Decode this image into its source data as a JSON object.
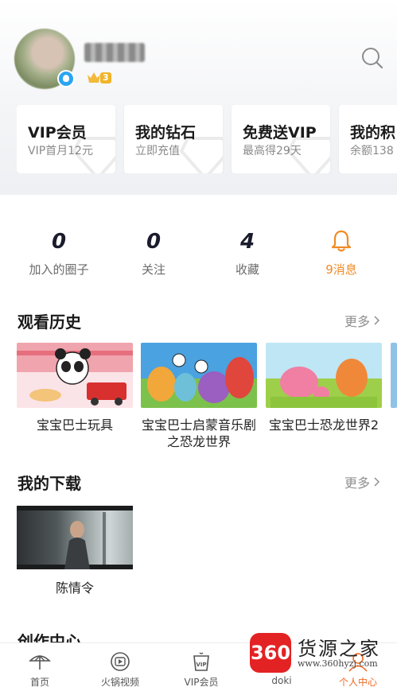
{
  "profile": {
    "level": "3"
  },
  "cards": [
    {
      "title": "VIP会员",
      "subtitle": "VIP首月12元"
    },
    {
      "title": "我的钻石",
      "subtitle": "立即充值"
    },
    {
      "title": "免费送VIP",
      "subtitle": "最高得29天"
    },
    {
      "title": "我的积",
      "subtitle": "余额138"
    }
  ],
  "stats": [
    {
      "value": "0",
      "label": "加入的圈子"
    },
    {
      "value": "0",
      "label": "关注"
    },
    {
      "value": "4",
      "label": "收藏"
    },
    {
      "value": "",
      "label": "9消息"
    }
  ],
  "history": {
    "title": "观看历史",
    "more": "更多",
    "items": [
      {
        "title": "宝宝巴士玩具"
      },
      {
        "title": "宝宝巴士启蒙音乐剧之恐龙世界"
      },
      {
        "title": "宝宝巴士恐龙世界2"
      }
    ]
  },
  "downloads": {
    "title": "我的下载",
    "more": "更多",
    "items": [
      {
        "title": "陈情令"
      }
    ]
  },
  "create": {
    "title": "创作中心"
  },
  "tabs": [
    {
      "label": "首页",
      "icon": "umbrella-icon"
    },
    {
      "label": "火锅视频",
      "icon": "hotpot-video-icon"
    },
    {
      "label": "VIP会员",
      "icon": "vip-cup-icon"
    },
    {
      "label": "doki",
      "icon": "doki-icon"
    },
    {
      "label": "个人中心",
      "icon": "profile-icon"
    }
  ],
  "watermark": {
    "logo_text": "360",
    "name": "货源之家",
    "url": "www.360hyzj.com"
  },
  "colors": {
    "accent": "#f06a23",
    "message": "#f08a24"
  }
}
